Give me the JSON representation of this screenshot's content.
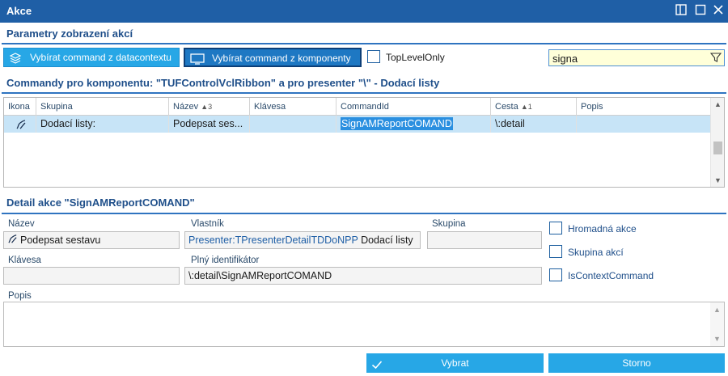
{
  "window": {
    "title": "Akce"
  },
  "params": {
    "section_title": "Parametry zobrazení akcí",
    "btn_datacontext": "Vybírat command z datacontextu",
    "btn_component": "Vybírat command z komponenty",
    "toplevel_label": "TopLevelOnly",
    "toplevel_checked": false,
    "search_value": "signa"
  },
  "commands": {
    "section_title": "Commandy pro komponentu: \"TUFControlVclRibbon\" a pro presenter \"\\\" - Dodací listy",
    "columns": [
      {
        "label": "Ikona",
        "sort": ""
      },
      {
        "label": "Skupina",
        "sort": ""
      },
      {
        "label": "Název",
        "sort": "▲3"
      },
      {
        "label": "Klávesa",
        "sort": ""
      },
      {
        "label": "CommandId",
        "sort": ""
      },
      {
        "label": "Cesta",
        "sort": "▲1"
      },
      {
        "label": "Popis",
        "sort": ""
      }
    ],
    "rows": [
      {
        "icon": "pen-icon",
        "skupina": "Dodací listy:",
        "nazev": "Podepsat ses...",
        "klavesa": "",
        "commandid": "SignAMReportCOMAND",
        "cesta": "\\:detail",
        "popis": ""
      }
    ]
  },
  "detail": {
    "section_title": "Detail akce \"SignAMReportCOMAND\"",
    "nazev_label": "Název",
    "nazev_value": "Podepsat sestavu",
    "vlastnik_label": "Vlastník",
    "vlastnik_link": "Presenter:TPresenterDetailTDDoNPP",
    "vlastnik_value": "Dodací listy",
    "skupina_label": "Skupina",
    "skupina_value": "",
    "klavesa_label": "Klávesa",
    "klavesa_value": "",
    "identifikator_label": "Plný identifikátor",
    "identifikator_value": "\\:detail\\SignAMReportCOMAND",
    "hromadna_label": "Hromadná akce",
    "skupina_akci_label": "Skupina akcí",
    "iscontext_label": "IsContextCommand",
    "popis_label": "Popis",
    "popis_value": ""
  },
  "footer": {
    "vybrat_label": "Vybrat",
    "storno_label": "Storno"
  },
  "colors": {
    "titlebar": "#1f5fa6",
    "button": "#27a7e6",
    "row_selected": "#c7e4f7",
    "section_text": "#1f4f8a"
  }
}
